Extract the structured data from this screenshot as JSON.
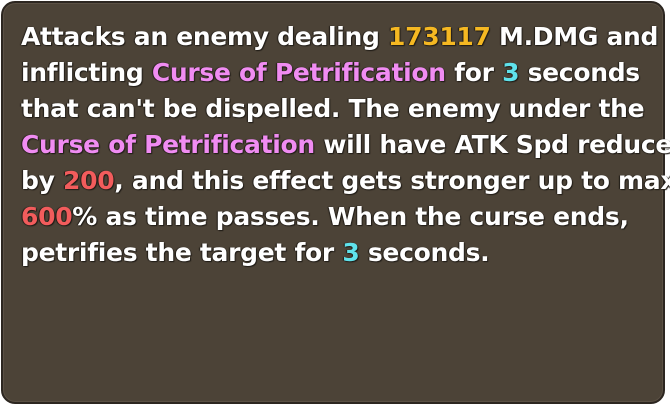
{
  "tooltip": {
    "lines": [
      [
        {
          "text": "Attacks an enemy dealing ",
          "style": "plain"
        },
        {
          "text": "173117",
          "style": "damage"
        },
        {
          "text": " M.DMG and",
          "style": "plain"
        }
      ],
      [
        {
          "text": "inflicting ",
          "style": "plain"
        },
        {
          "text": "Curse of Petrification",
          "style": "curse"
        },
        {
          "text": " for ",
          "style": "plain"
        },
        {
          "text": "3",
          "style": "number"
        },
        {
          "text": " seconds",
          "style": "plain"
        }
      ],
      [
        {
          "text": "that can't be dispelled. The enemy under the",
          "style": "plain"
        }
      ],
      [
        {
          "text": "Curse of Petrification",
          "style": "curse"
        },
        {
          "text": " will have ATK Spd reduced",
          "style": "plain"
        }
      ],
      [
        {
          "text": "by ",
          "style": "plain"
        },
        {
          "text": "200",
          "style": "percent"
        },
        {
          "text": ", and this effect gets stronger up to max",
          "style": "plain"
        }
      ],
      [
        {
          "text": "600",
          "style": "percent"
        },
        {
          "text": "% as time passes. When the curse ends,",
          "style": "plain"
        }
      ],
      [
        {
          "text": "petrifies the target for ",
          "style": "plain"
        },
        {
          "text": "3",
          "style": "number"
        },
        {
          "text": " seconds.",
          "style": "plain"
        }
      ]
    ]
  },
  "colors": {
    "panel_background": "#4c4337",
    "text_plain": "#ffffff",
    "text_damage": "#f5b822",
    "text_curse": "#f08cf2",
    "text_number": "#5fe2ec",
    "text_percent": "#f25c5c"
  }
}
